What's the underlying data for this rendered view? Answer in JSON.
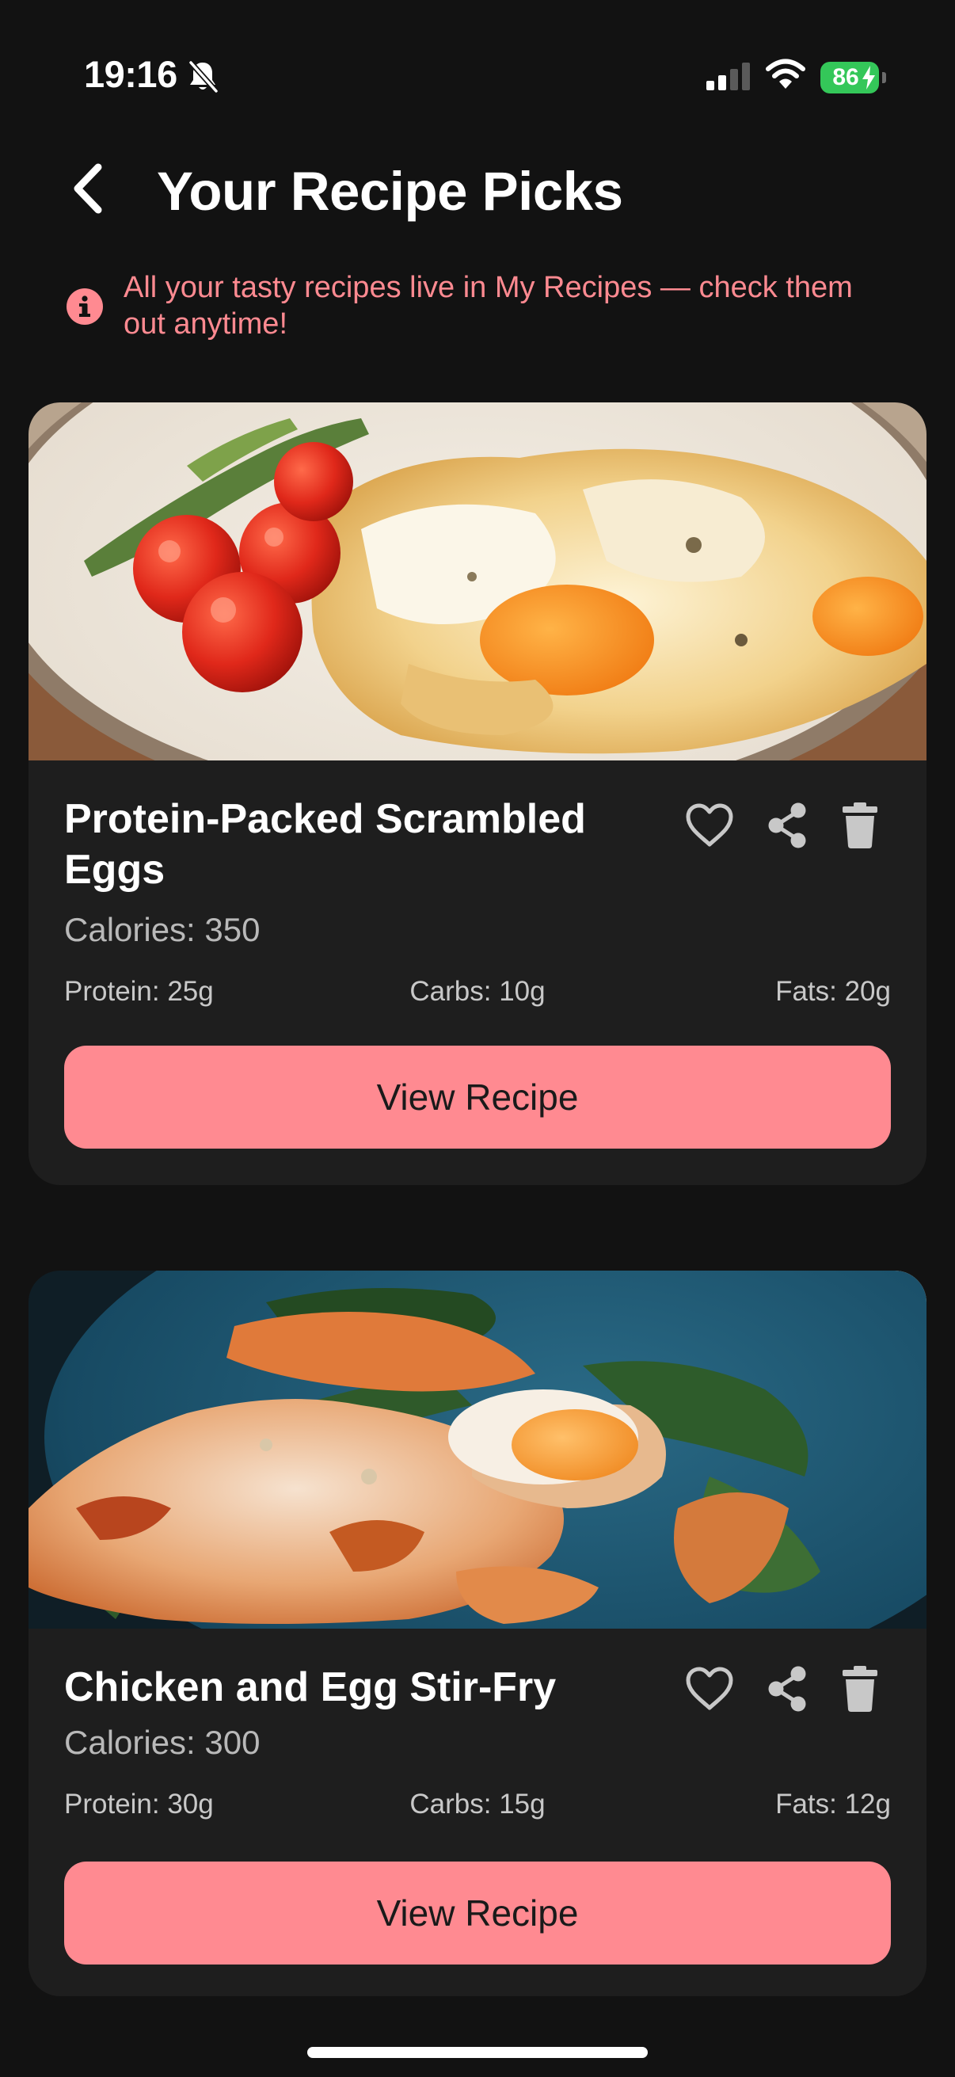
{
  "status_bar": {
    "time": "19:16",
    "battery_level": "86",
    "icons": [
      "bell-slash-icon",
      "cellular-signal-icon",
      "wifi-icon",
      "battery-charging-icon"
    ],
    "battery_color": "#34c759"
  },
  "header": {
    "back_icon": "chevron-left-icon",
    "title": "Your Recipe Picks"
  },
  "info_banner": {
    "icon": "info-icon",
    "text": "All your tasty recipes live in My Recipes — check them out anytime!"
  },
  "theme": {
    "background": "#121212",
    "card_background": "#1e1e1e",
    "accent": "#ff8a91",
    "button_text": "#1a1a1a"
  },
  "recipes": [
    {
      "title": "Protein-Packed Scrambled Eggs",
      "calories": "Calories: 350",
      "protein": "Protein: 25g",
      "carbs": "Carbs: 10g",
      "fats": "Fats: 20g",
      "image": "scrambled-eggs-with-cherry-tomatoes-photo",
      "actions": [
        "heart-icon",
        "share-icon",
        "trash-icon"
      ],
      "button_label": "View Recipe"
    },
    {
      "title": "Chicken and Egg Stir-Fry",
      "calories": "Calories: 300",
      "protein": "Protein: 30g",
      "carbs": "Carbs: 15g",
      "fats": "Fats: 12g",
      "image": "chicken-and-egg-stir-fry-in-blue-bowl-photo",
      "actions": [
        "heart-icon",
        "share-icon",
        "trash-icon"
      ],
      "button_label": "View Recipe"
    }
  ]
}
